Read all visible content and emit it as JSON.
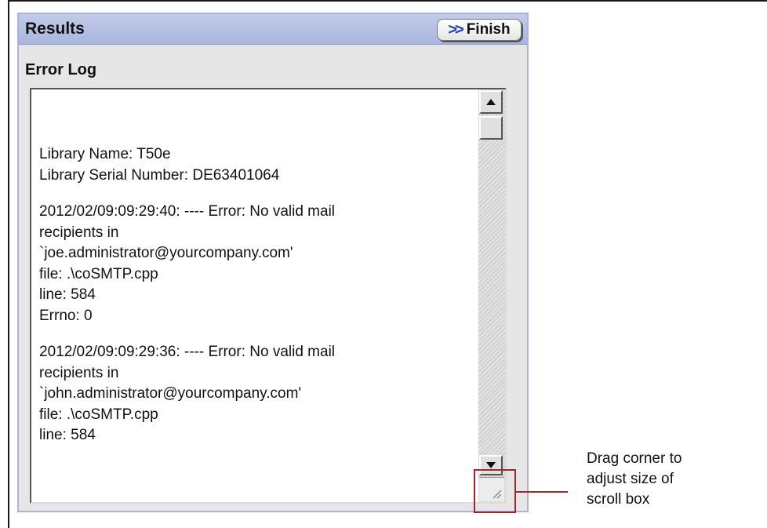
{
  "results_panel": {
    "title": "Results",
    "finish_button": {
      "label": "Finish",
      "icon": "double-chevron-right"
    },
    "section_label": "Error Log"
  },
  "error_log": {
    "lines": [
      "Library Name: T50e",
      "Library Serial Number: DE63401064",
      "",
      "2012/02/09:09:29:40: ---- Error: No valid mail",
      "recipients in",
      "`joe.administrator@yourcompany.com'",
      "file: .\\coSMTP.cpp",
      "line: 584",
      "Errno: 0",
      "",
      "2012/02/09:09:29:36: ---- Error: No valid mail",
      "recipients in",
      "`john.administrator@yourcompany.com'",
      "file: .\\coSMTP.cpp",
      "line: 584"
    ]
  },
  "annotation": {
    "callout_lines": [
      "Drag corner to",
      "adjust size of",
      "scroll box"
    ],
    "accent_color": "#9b2830"
  }
}
